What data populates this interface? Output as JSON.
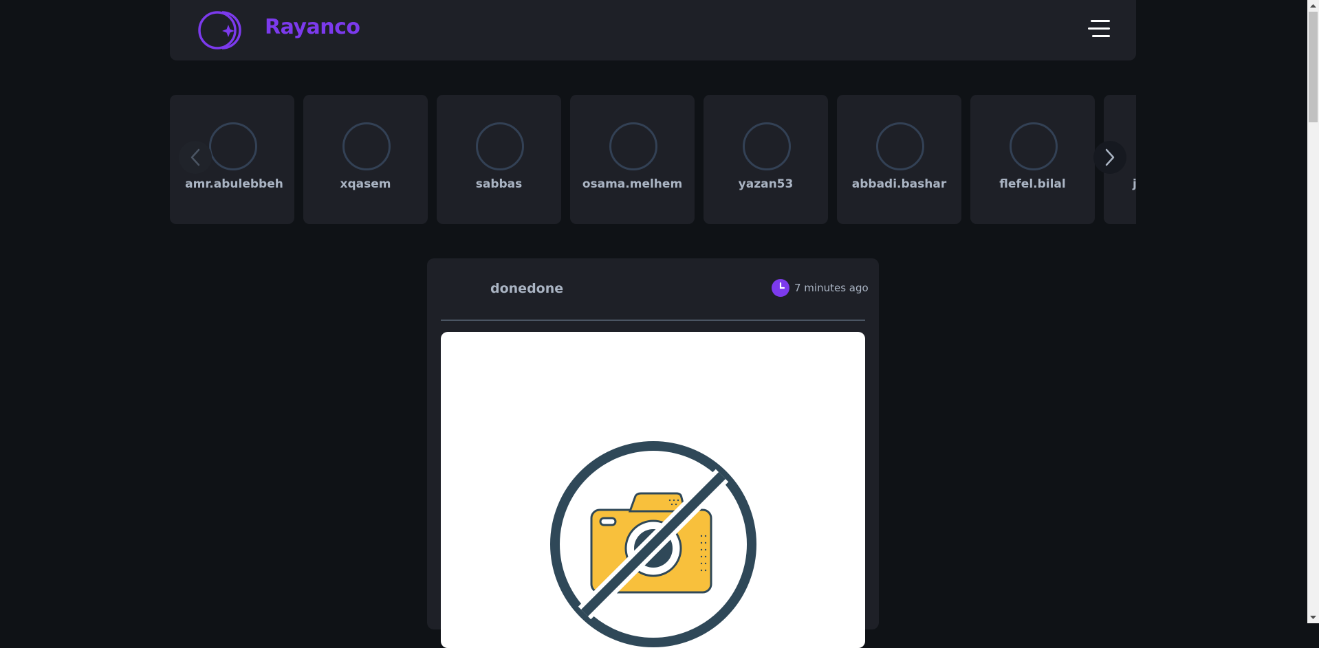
{
  "header": {
    "brand": "Rayanco",
    "brand_color": "#7c3aed",
    "logo_icon": "rayanco-logo",
    "menu_icon": "hamburger-menu-icon"
  },
  "stories": {
    "items": [
      {
        "username": "amr.abulebbeh"
      },
      {
        "username": "xqasem"
      },
      {
        "username": "sabbas"
      },
      {
        "username": "osama.melhem"
      },
      {
        "username": "yazan53"
      },
      {
        "username": "abbadi.bashar"
      },
      {
        "username": "flefel.bilal"
      },
      {
        "username": "j"
      }
    ],
    "prev_icon": "chevron-left-icon",
    "next_icon": "chevron-right-icon"
  },
  "post": {
    "author": "donedone",
    "time": "7 minutes ago",
    "clock_icon": "clock-icon",
    "image_icon": "no-camera-icon"
  }
}
